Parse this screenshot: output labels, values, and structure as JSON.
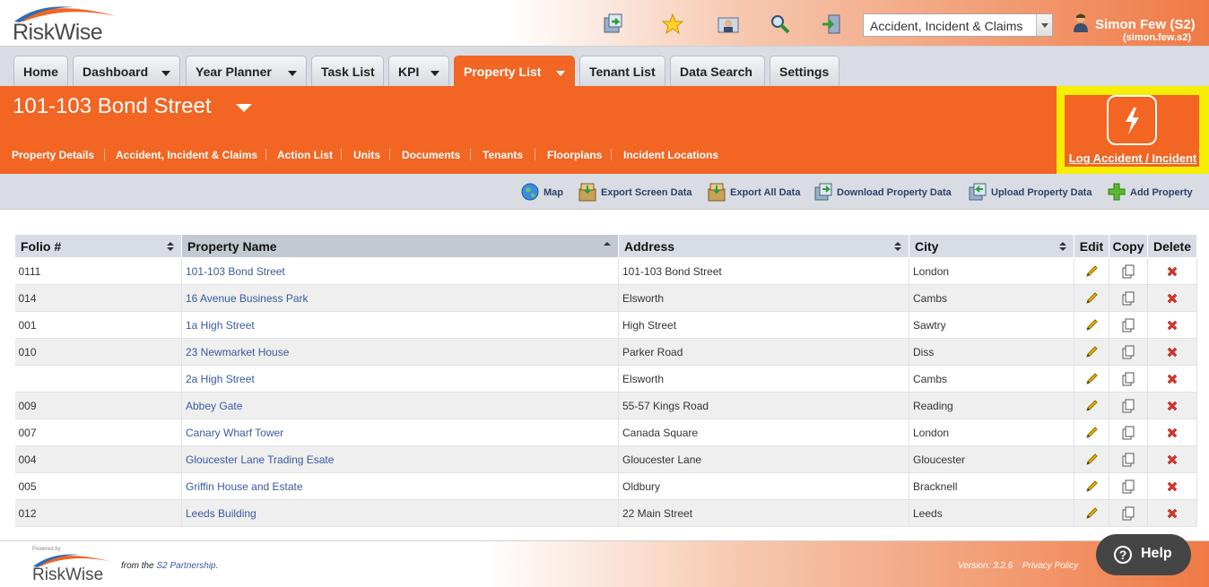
{
  "app": {
    "logo_text": "RiskWise"
  },
  "toolbar": {
    "icons": [
      "refresh-icon",
      "favourite-star-icon",
      "contact-icon",
      "search-icon",
      "logout-icon"
    ],
    "module_select": "Accident, Incident & Claims",
    "user_name": "Simon Few (S2)",
    "user_login": "(simon.few.s2)"
  },
  "tabs": [
    {
      "label": "Home"
    },
    {
      "label": "Dashboard"
    },
    {
      "label": "Year Planner"
    },
    {
      "label": "Task List"
    },
    {
      "label": "KPI"
    },
    {
      "label": "Property List"
    },
    {
      "label": "Tenant List"
    },
    {
      "label": "Data Search"
    },
    {
      "label": "Settings"
    }
  ],
  "banner": {
    "title": "101-103 Bond Street",
    "subnav": [
      "Property Details",
      "Accident, Incident & Claims",
      "Action List",
      "Units",
      "Documents",
      "Tenants",
      "Floorplans",
      "Incident Locations"
    ],
    "log_label": "Log Accident / Incident"
  },
  "actions": [
    {
      "label": "Map",
      "icon": "globe-icon"
    },
    {
      "label": "Export Screen Data",
      "icon": "export-box-icon"
    },
    {
      "label": "Export All Data",
      "icon": "export-box-icon"
    },
    {
      "label": "Download Property Data",
      "icon": "download-icon"
    },
    {
      "label": "Upload Property Data",
      "icon": "upload-icon"
    },
    {
      "label": "Add Property",
      "icon": "plus-icon"
    }
  ],
  "table": {
    "headers": [
      "Folio #",
      "Property Name",
      "Address",
      "City",
      "Edit",
      "Copy",
      "Delete"
    ],
    "rows": [
      {
        "folio": "0111",
        "name": "101-103 Bond Street",
        "address": "101-103 Bond Street",
        "city": "London"
      },
      {
        "folio": "014",
        "name": "16 Avenue Business Park",
        "address": "Elsworth",
        "city": "Cambs"
      },
      {
        "folio": "001",
        "name": "1a High Street",
        "address": "High Street",
        "city": "Sawtry"
      },
      {
        "folio": "010",
        "name": "23 Newmarket House",
        "address": "Parker Road",
        "city": "Diss"
      },
      {
        "folio": "",
        "name": "2a High Street",
        "address": "Elsworth",
        "city": "Cambs"
      },
      {
        "folio": "009",
        "name": "Abbey Gate",
        "address": "55-57 Kings Road",
        "city": "Reading"
      },
      {
        "folio": "007",
        "name": "Canary Wharf Tower",
        "address": "Canada Square",
        "city": "London"
      },
      {
        "folio": "004",
        "name": "Gloucester Lane Trading Esate",
        "address": "Gloucester Lane",
        "city": "Gloucester"
      },
      {
        "folio": "005",
        "name": "Griffin House and Estate",
        "address": "Oldbury",
        "city": "Bracknell"
      },
      {
        "folio": "012",
        "name": "Leeds Building",
        "address": "22 Main Street",
        "city": "Leeds"
      }
    ]
  },
  "footer": {
    "powered_by": "Powered by",
    "logo_text": "RiskWise",
    "partner_prefix": "from the",
    "partner_name": "S2 Partnership.",
    "version": "Version: 3.2.6",
    "privacy": "Privacy Policy",
    "help": "Help"
  },
  "colors": {
    "brand_orange": "#f26522",
    "highlight_yellow": "#f7ee08",
    "nav_grey": "#d9dde3",
    "link_blue": "#3a5aa0"
  }
}
